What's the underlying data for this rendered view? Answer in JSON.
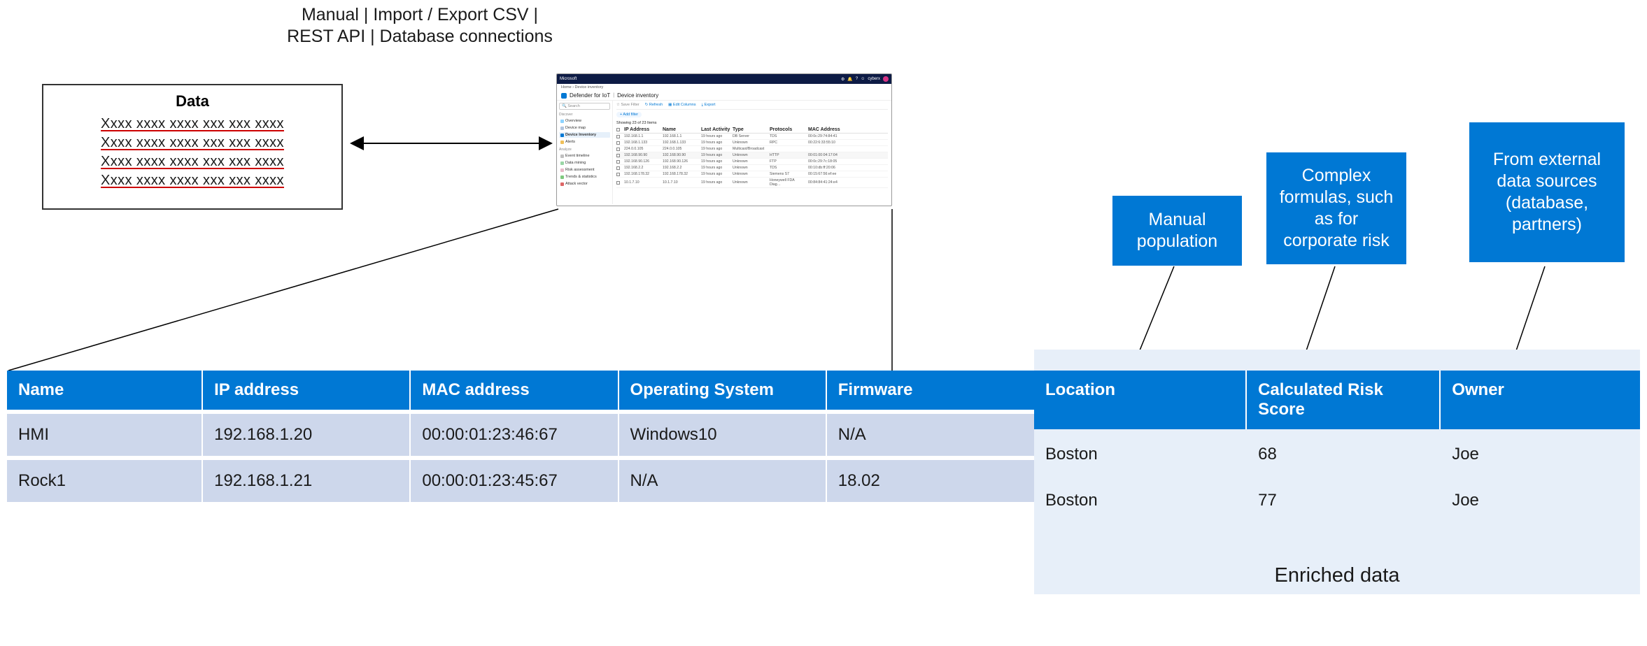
{
  "top_caption": "Manual | Import / Export CSV |\nREST API | Database connections",
  "data_box": {
    "title": "Data",
    "line": "Xxxx xxxx xxxx xxx xxx xxxx"
  },
  "mini_app": {
    "brand": "Microsoft",
    "header_user": "cyberx",
    "breadcrumb": "Home  ›  Device inventory",
    "product": "Defender for IoT",
    "page_title": "Device inventory",
    "search_placeholder": "Search",
    "sections": {
      "discover": "Discover",
      "analyze": "Analyze"
    },
    "nav": {
      "overview": "Overview",
      "device_map": "Device map",
      "device_inventory": "Device Inventory",
      "alerts": "Alerts",
      "event_timeline": "Event timeline",
      "data_mining": "Data mining",
      "risk_assessment": "Risk assessment",
      "trends_statistics": "Trends & statistics",
      "attack_vector": "Attack vector"
    },
    "toolbar": {
      "save_filter": "Save Filter",
      "refresh": "Refresh",
      "edit_columns": "Edit Columns",
      "export": "Export"
    },
    "add_filter": "+ Add filter",
    "showing": "Showing 23 of 23 Items",
    "columns": {
      "ip": "IP Address",
      "name": "Name",
      "last": "Last Activity",
      "type": "Type",
      "protocols": "Protocols",
      "mac": "MAC Address"
    },
    "rows": [
      {
        "ip": "192.168.1.1",
        "name": "192.168.1.1",
        "last": "19 hours ago",
        "type": "DB Server",
        "protocols": "TDS",
        "mac": "00:0c:29:74:84:41"
      },
      {
        "ip": "192.168.1.133",
        "name": "192.168.1.133",
        "last": "19 hours ago",
        "type": "Unknown",
        "protocols": "RPC",
        "mac": "00:22:6:33:55:10"
      },
      {
        "ip": "224.0.0.105",
        "name": "224.0.0.105",
        "last": "19 hours ago",
        "type": "Multicast/Broadcast",
        "protocols": "",
        "mac": ""
      },
      {
        "ip": "192.168.90.90",
        "name": "192.168.90.90",
        "last": "19 hours ago",
        "type": "Unknown",
        "protocols": "HTTP",
        "mac": "00:01:00:04:17:04"
      },
      {
        "ip": "192.168.90.126",
        "name": "192.168.90.126",
        "last": "19 hours ago",
        "type": "Unknown",
        "protocols": "FTP",
        "mac": "00:0c:29:7c:18:05"
      },
      {
        "ip": "192.168.2.2",
        "name": "192.168.2.2",
        "last": "19 hours ago",
        "type": "Unknown",
        "protocols": "TDS",
        "mac": "00:10:db:ff:20:06"
      },
      {
        "ip": "192.168.178.32",
        "name": "192.168.178.32",
        "last": "19 hours ago",
        "type": "Unknown",
        "protocols": "Siemens S7",
        "mac": "00:15:67:56:ef:ee"
      },
      {
        "ip": "10.1.7.10",
        "name": "10.1.7.10",
        "last": "19 hours ago",
        "type": "Unknown",
        "protocols": "Honeywell FDA Diag…",
        "mac": "00:84:84:41:24:e4"
      }
    ]
  },
  "callouts": {
    "manual": "Manual population",
    "formulas": "Complex formulas, such as for corporate risk",
    "external": "From external data sources (database, partners)"
  },
  "big_table": {
    "headers": {
      "name": "Name",
      "ip": "IP address",
      "mac": "MAC address",
      "os": "Operating System",
      "fw": "Firmware"
    },
    "rows": [
      {
        "name": "HMI",
        "ip": "192.168.1.20",
        "mac": "00:00:01:23:46:67",
        "os": "Windows10",
        "fw": "N/A"
      },
      {
        "name": "Rock1",
        "ip": "192.168.1.21",
        "mac": "00:00:01:23:45:67",
        "os": "N/A",
        "fw": "18.02"
      }
    ]
  },
  "enriched": {
    "label": "Enriched data",
    "headers": {
      "location": "Location",
      "risk": "Calculated Risk Score",
      "owner": "Owner"
    },
    "rows": [
      {
        "location": "Boston",
        "risk": "68",
        "owner": "Joe"
      },
      {
        "location": "Boston",
        "risk": "77",
        "owner": "Joe"
      }
    ]
  }
}
